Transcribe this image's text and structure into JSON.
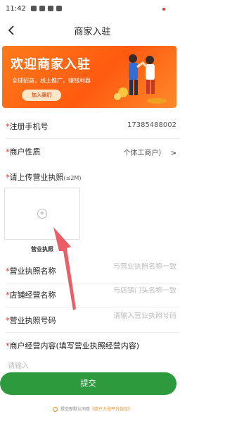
{
  "status_bar": {
    "time": "11:42"
  },
  "nav": {
    "title": "商家入驻"
  },
  "banner": {
    "title": "欢迎商家入驻",
    "subtitle": "全球招商，线上推广，赚钱利器",
    "button_label": "加入我们"
  },
  "form": {
    "phone": {
      "label": "注册手机号",
      "value": "17385488002"
    },
    "merchant_type": {
      "label": "商户性质",
      "value": "个体工商户）",
      "chevron": ">"
    },
    "upload": {
      "label": "请上传营业执照",
      "hint": "(≤2M)",
      "caption": "营业执照"
    },
    "license_name": {
      "label": "营业执照名称",
      "placeholder": "与营业执照名称一致"
    },
    "store_name": {
      "label": "店铺经营名称",
      "placeholder": "与店铺门头名称一致"
    },
    "license_number": {
      "label": "营业执照号码",
      "placeholder": "请输入营业执照号码"
    },
    "business_scope": {
      "label": "商户经营内容(填写营业执照经营内容)",
      "placeholder": "请输入"
    },
    "required_mark": "*"
  },
  "submit": {
    "label": "提交"
  },
  "agreement": {
    "text": "提交即默认同意",
    "link": "《商户入驻平台协议》"
  },
  "colors": {
    "accent": "#2e9a3e",
    "banner": "#ff5a10",
    "annotation": "#e8505b"
  }
}
